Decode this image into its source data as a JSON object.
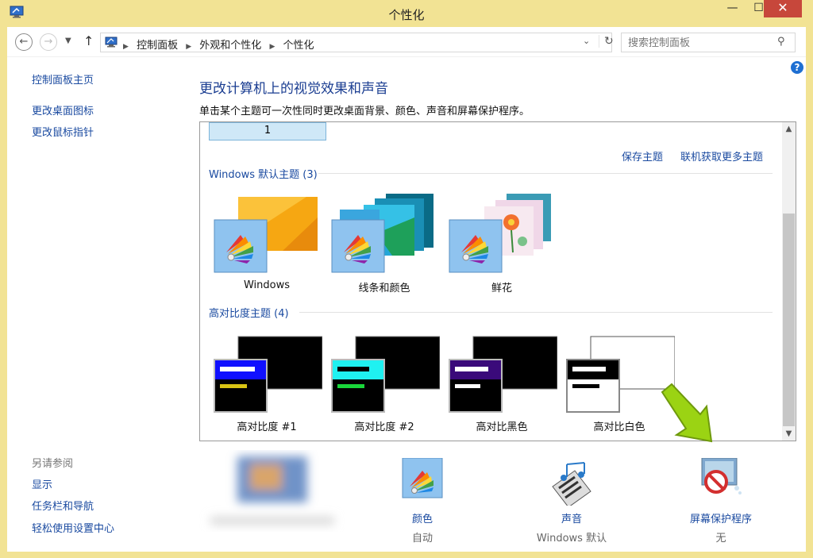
{
  "window": {
    "title": "个性化",
    "minimize": "—",
    "maximize": "☐",
    "close": "✕"
  },
  "navigation": {
    "breadcrumbs": [
      "控制面板",
      "外观和个性化",
      "个性化"
    ],
    "search_placeholder": "搜索控制面板"
  },
  "sidebar": {
    "links": [
      "控制面板主页",
      "更改桌面图标",
      "更改鼠标指针"
    ],
    "see_also_heading": "另请参阅",
    "see_also": [
      "显示",
      "任务栏和导航",
      "轻松使用设置中心"
    ]
  },
  "main": {
    "title": "更改计算机上的视觉效果和声音",
    "description": "单击某个主题可一次性同时更改桌面背景、颜色、声音和屏幕保护程序。",
    "my_theme_label": "1",
    "save_theme_link": "保存主题",
    "get_more_link": "联机获取更多主题",
    "default_group_label": "Windows 默认主题 (3)",
    "high_contrast_group_label": "高对比度主题 (4)",
    "default_themes": [
      "Windows",
      "线条和颜色",
      "鲜花"
    ],
    "high_contrast_themes": [
      "高对比度 #1",
      "高对比度 #2",
      "高对比黑色",
      "高对比白色"
    ]
  },
  "bottom_bar": {
    "color": {
      "label": "颜色",
      "value": "自动"
    },
    "sounds": {
      "label": "声音",
      "value": "Windows 默认"
    },
    "screensaver": {
      "label": "屏幕保护程序",
      "value": "无"
    }
  },
  "colors": {
    "window_frame": "#f2e394",
    "link": "#1a4aa0",
    "title_blue": "#1a3d91",
    "close_red": "#c7473b",
    "arrow_green": "#9bd313"
  }
}
